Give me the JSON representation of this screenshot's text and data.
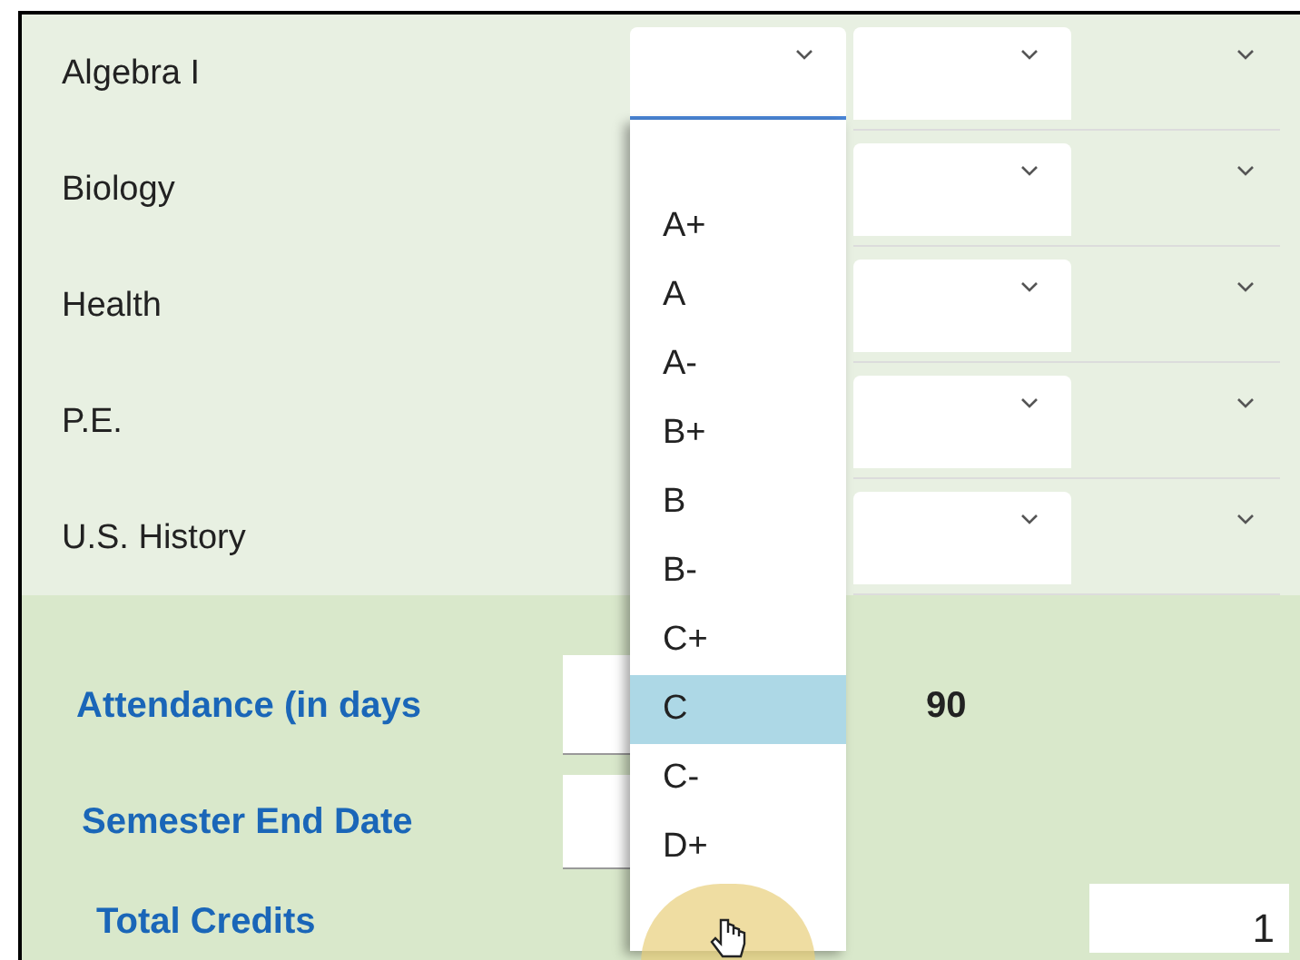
{
  "courses": [
    {
      "name": "Algebra I"
    },
    {
      "name": "Biology"
    },
    {
      "name": "Health"
    },
    {
      "name": "P.E."
    },
    {
      "name": "U.S. History"
    }
  ],
  "grade_dropdown": {
    "options": [
      {
        "label": "A+",
        "selected": false
      },
      {
        "label": "A",
        "selected": false
      },
      {
        "label": "A-",
        "selected": false
      },
      {
        "label": "B+",
        "selected": false
      },
      {
        "label": "B",
        "selected": false
      },
      {
        "label": "B-",
        "selected": false
      },
      {
        "label": "C+",
        "selected": false
      },
      {
        "label": "C",
        "selected": true
      },
      {
        "label": "C-",
        "selected": false
      },
      {
        "label": "D+",
        "selected": false
      }
    ]
  },
  "attendance": {
    "label": "Attendance (in days",
    "value": "90"
  },
  "semester_end_date": {
    "label": "Semester End Date"
  },
  "total_credits": {
    "label": "Total Credits",
    "value": "1"
  }
}
